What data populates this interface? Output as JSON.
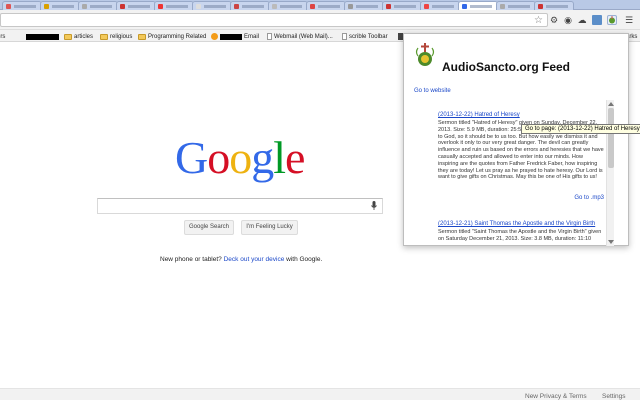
{
  "toolbar": {
    "menu_icon": "menu-icon",
    "bookmark_star_icon": "star-icon"
  },
  "bookmarks": {
    "items": [
      {
        "label": "ers",
        "type": "text"
      },
      {
        "label": "articles",
        "type": "folder"
      },
      {
        "label": "religious",
        "type": "folder"
      },
      {
        "label": "Programming Related",
        "type": "folder"
      },
      {
        "label": "Email",
        "type": "redacted-link"
      },
      {
        "label": "Webmail (Web Mail)...",
        "type": "page"
      },
      {
        "label": "scrible Toolbar",
        "type": "page"
      },
      {
        "label": "marks",
        "type": "text"
      }
    ]
  },
  "google": {
    "logo_letters": [
      "G",
      "o",
      "o",
      "g",
      "l",
      "e"
    ],
    "search_button": "Google Search",
    "lucky_button": "I'm Feeling Lucky",
    "promo_prefix": "New phone or tablet?",
    "promo_link": "Deck out your device",
    "promo_suffix": "with Google.",
    "footer_links": [
      "New Privacy & Terms",
      "Settings"
    ]
  },
  "popup": {
    "title": "AudioSancto.org Feed",
    "go_to_website": "Go to website",
    "entries": [
      {
        "title": "(2013-12-22) Hatred of Heresy",
        "description": "Sermon titled \"Hatred of Heresy\" given on Sunday, December 22, 2013. Size: 5.9 MB, duration: 25:50. Do we have a hateful heresy is to God, so it should be to us too. But how easily we dismiss it and overlook it only to our very great danger. The devil can greatly influence and ruin us based on the errors and heresies that we have casually accepted and allowed to enter into our minds. How inspiring are the quotes from Father Fredrick Faber, how inspiring they are today! Let us pray as he prayed to hate heresy. Our Lord is want to give gifts on Christmas. May this be one of His gifts to us!",
        "mp3_link": "Go to .mp3"
      },
      {
        "title": "(2013-12-21) Saint Thomas the Apostle and the Virgin Birth",
        "description": "Sermon titled \"Saint Thomas the Apostle and the Virgin Birth\" given on Saturday December 21, 2013. Size: 3.8 MB, duration: 11:10",
        "mp3_link": ""
      }
    ],
    "tooltip": "Go to page: (2013-12-22) Hatred of Heresy"
  },
  "colors": {
    "google_blue": "#3369e8",
    "google_red": "#d50f25",
    "google_yellow": "#eeb211",
    "google_green": "#009925",
    "link": "#1a47c8"
  }
}
